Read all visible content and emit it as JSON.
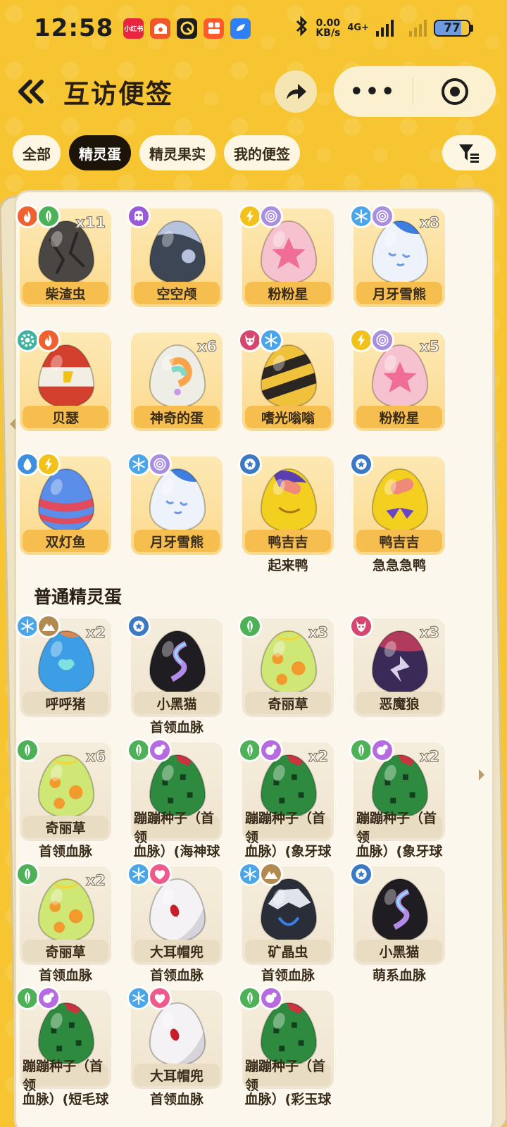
{
  "status_bar": {
    "time": "12:58",
    "speed_value": "0.00",
    "speed_unit": "KB/s",
    "network": "4G+",
    "battery": "77",
    "battery_fraction": 0.77
  },
  "header": {
    "title": "互访便签",
    "more_label": "•••"
  },
  "tabs": [
    {
      "label": "全部",
      "active": false
    },
    {
      "label": "精灵蛋",
      "active": true
    },
    {
      "label": "精灵果实",
      "active": false
    },
    {
      "label": "我的便签",
      "active": false
    }
  ],
  "special_eggs": [
    {
      "name": "柴渣虫",
      "sub": "",
      "qty": "x11",
      "badges": [
        "fire-icon",
        "leaf-icon"
      ],
      "egg": "egg-charcoal"
    },
    {
      "name": "空空颅",
      "sub": "",
      "qty": "",
      "badges": [
        "ghost-icon"
      ],
      "egg": "egg-skull"
    },
    {
      "name": "粉粉星",
      "sub": "",
      "qty": "",
      "badges": [
        "lightning-icon",
        "swirl-icon"
      ],
      "egg": "egg-pink-star"
    },
    {
      "name": "月牙雪熊",
      "sub": "",
      "qty": "x8",
      "badges": [
        "snowflake-icon",
        "swirl-icon"
      ],
      "egg": "egg-snow-bear"
    },
    {
      "name": "贝瑟",
      "sub": "",
      "qty": "",
      "badges": [
        "gear-icon",
        "fire-icon"
      ],
      "egg": "egg-red-white"
    },
    {
      "name": "神奇的蛋",
      "sub": "",
      "qty": "x6",
      "badges": [],
      "egg": "egg-rainbow"
    },
    {
      "name": "嗜光嗡嗡",
      "sub": "",
      "qty": "",
      "badges": [
        "demon-icon",
        "snowflake-icon"
      ],
      "egg": "egg-bee"
    },
    {
      "name": "粉粉星",
      "sub": "",
      "qty": "x5",
      "badges": [
        "lightning-icon",
        "swirl-icon"
      ],
      "egg": "egg-pink-star"
    },
    {
      "name": "双灯鱼",
      "sub": "",
      "qty": "",
      "badges": [
        "water-icon",
        "lightning-icon"
      ],
      "egg": "egg-lantern-fish"
    },
    {
      "name": "月牙雪熊",
      "sub": "",
      "qty": "",
      "badges": [
        "snowflake-icon",
        "swirl-icon"
      ],
      "egg": "egg-snow-bear"
    },
    {
      "name": "鸭吉吉",
      "sub": "起来鸭",
      "qty": "",
      "badges": [
        "star-icon"
      ],
      "egg": "egg-duck-a"
    },
    {
      "name": "鸭吉吉",
      "sub": "急急急鸭",
      "qty": "",
      "badges": [
        "star-icon"
      ],
      "egg": "egg-duck-b"
    }
  ],
  "section_title": "普通精灵蛋",
  "normal_eggs": [
    {
      "name": "呼呼猪",
      "sub": "",
      "qty": "x2",
      "badges": [
        "snowflake-icon",
        "mountain-icon"
      ],
      "egg": "egg-pig"
    },
    {
      "name": "小黑猫",
      "sub": "首领血脉",
      "qty": "",
      "badges": [
        "star-icon"
      ],
      "egg": "egg-black-cat"
    },
    {
      "name": "奇丽草",
      "sub": "",
      "qty": "x3",
      "badges": [
        "leaf-icon"
      ],
      "egg": "egg-grass"
    },
    {
      "name": "恶魔狼",
      "sub": "",
      "qty": "x3",
      "badges": [
        "demon-icon"
      ],
      "egg": "egg-demon-wolf"
    },
    {
      "name": "奇丽草",
      "sub": "首领血脉",
      "qty": "x6",
      "badges": [
        "leaf-icon"
      ],
      "egg": "egg-grass"
    },
    {
      "name": "蹦蹦种子（首领",
      "sub": "血脉）(海神球",
      "qty": "",
      "badges": [
        "leaf-icon",
        "bubble-icon"
      ],
      "egg": "egg-seed"
    },
    {
      "name": "蹦蹦种子（首领",
      "sub": "血脉）(象牙球",
      "qty": "x2",
      "badges": [
        "leaf-icon",
        "bubble-icon"
      ],
      "egg": "egg-seed"
    },
    {
      "name": "蹦蹦种子（首领",
      "sub": "血脉）(象牙球",
      "qty": "x2",
      "badges": [
        "leaf-icon",
        "bubble-icon"
      ],
      "egg": "egg-seed"
    },
    {
      "name": "奇丽草",
      "sub": "首领血脉",
      "qty": "x2",
      "badges": [
        "leaf-icon"
      ],
      "egg": "egg-grass"
    },
    {
      "name": "大耳帽兜",
      "sub": "首领血脉",
      "qty": "",
      "badges": [
        "snowflake-icon",
        "heart-icon"
      ],
      "egg": "egg-hood"
    },
    {
      "name": "矿晶虫",
      "sub": "首领血脉",
      "qty": "",
      "badges": [
        "snowflake-icon",
        "mountain-icon"
      ],
      "egg": "egg-crystal-bug"
    },
    {
      "name": "小黑猫",
      "sub": "萌系血脉",
      "qty": "",
      "badges": [
        "star-icon"
      ],
      "egg": "egg-black-cat"
    },
    {
      "name": "蹦蹦种子（首领",
      "sub": "血脉）(短毛球",
      "qty": "",
      "badges": [
        "leaf-icon",
        "bubble-icon"
      ],
      "egg": "egg-seed"
    },
    {
      "name": "大耳帽兜",
      "sub": "首领血脉",
      "qty": "",
      "badges": [
        "snowflake-icon",
        "heart-icon"
      ],
      "egg": "egg-hood"
    },
    {
      "name": "蹦蹦种子（首领",
      "sub": "血脉）(彩玉球",
      "qty": "",
      "badges": [
        "leaf-icon",
        "bubble-icon"
      ],
      "egg": "egg-seed"
    }
  ],
  "colors": {
    "background": "#f7c531",
    "active_tab": "#1c1408",
    "special_label": "#f6be4e",
    "normal_label": "#e8dcc2"
  }
}
